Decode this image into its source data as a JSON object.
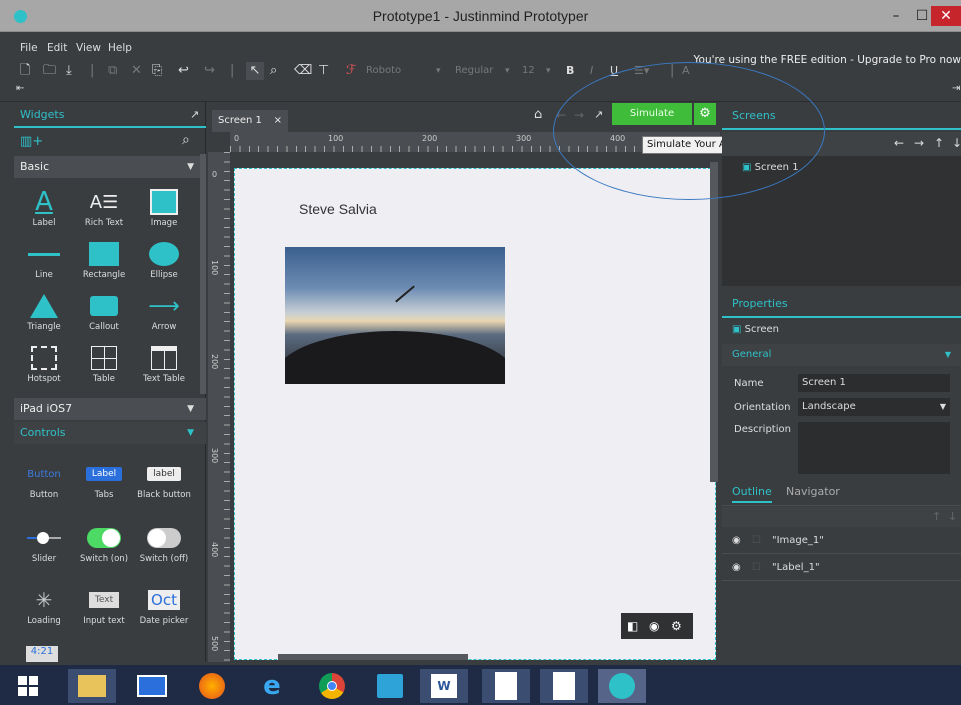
{
  "window": {
    "title": "Prototype1 - Justinmind Prototyper"
  },
  "menu": [
    "File",
    "Edit",
    "View",
    "Help"
  ],
  "toolbar": {
    "font": "Roboto",
    "weight": "Regular",
    "size": "12",
    "bold": "B",
    "italic": "I",
    "underline": "U",
    "a_label": "A"
  },
  "upgrade_text": "You're using the FREE edition - Upgrade to Pro now",
  "left": {
    "tab": "Widgets",
    "sections": {
      "basic": "Basic",
      "ipad": "iPad iOS7",
      "controls": "Controls"
    },
    "basic_widgets": [
      "Label",
      "Rich Text",
      "Image",
      "Line",
      "Rectangle",
      "Ellipse",
      "Triangle",
      "Callout",
      "Arrow",
      "Hotspot",
      "Table",
      "Text Table"
    ],
    "control_widgets": [
      "Button",
      "Tabs",
      "Black button",
      "Slider",
      "Switch (on)",
      "Switch (off)",
      "Loading",
      "Input text",
      "Date picker"
    ],
    "control_icon_text": {
      "button": "Button",
      "tabs": "Label",
      "black": "label",
      "input": "Text",
      "date": "Oct"
    },
    "partial_icon_text": "4:21"
  },
  "canvas": {
    "tab": "Screen 1",
    "simulate": "Simulate",
    "tooltip": "Simulate Your Application (F5)",
    "ruler_h": [
      "0",
      "100",
      "200",
      "300",
      "400"
    ],
    "ruler_v": [
      "0",
      "100",
      "200",
      "300",
      "400",
      "500"
    ],
    "label_text": "Steve Salvia"
  },
  "right": {
    "screens_tab": "Screens",
    "screen_item": "Screen 1",
    "properties_tab": "Properties",
    "properties_screen": "Screen",
    "general": "General",
    "fields": {
      "name_label": "Name",
      "name_value": "Screen 1",
      "orientation_label": "Orientation",
      "orientation_value": "Landscape",
      "description_label": "Description"
    },
    "outline_tab": "Outline",
    "navigator_tab": "Navigator",
    "outline_items": [
      "\"Image_1\"",
      "\"Label_1\""
    ]
  },
  "colors": {
    "accent": "#2ec1c8",
    "simulate": "#3fbc39",
    "panel": "#3a3d40",
    "taskbar": "#1f2a44",
    "annotation": "#3b79c2"
  }
}
